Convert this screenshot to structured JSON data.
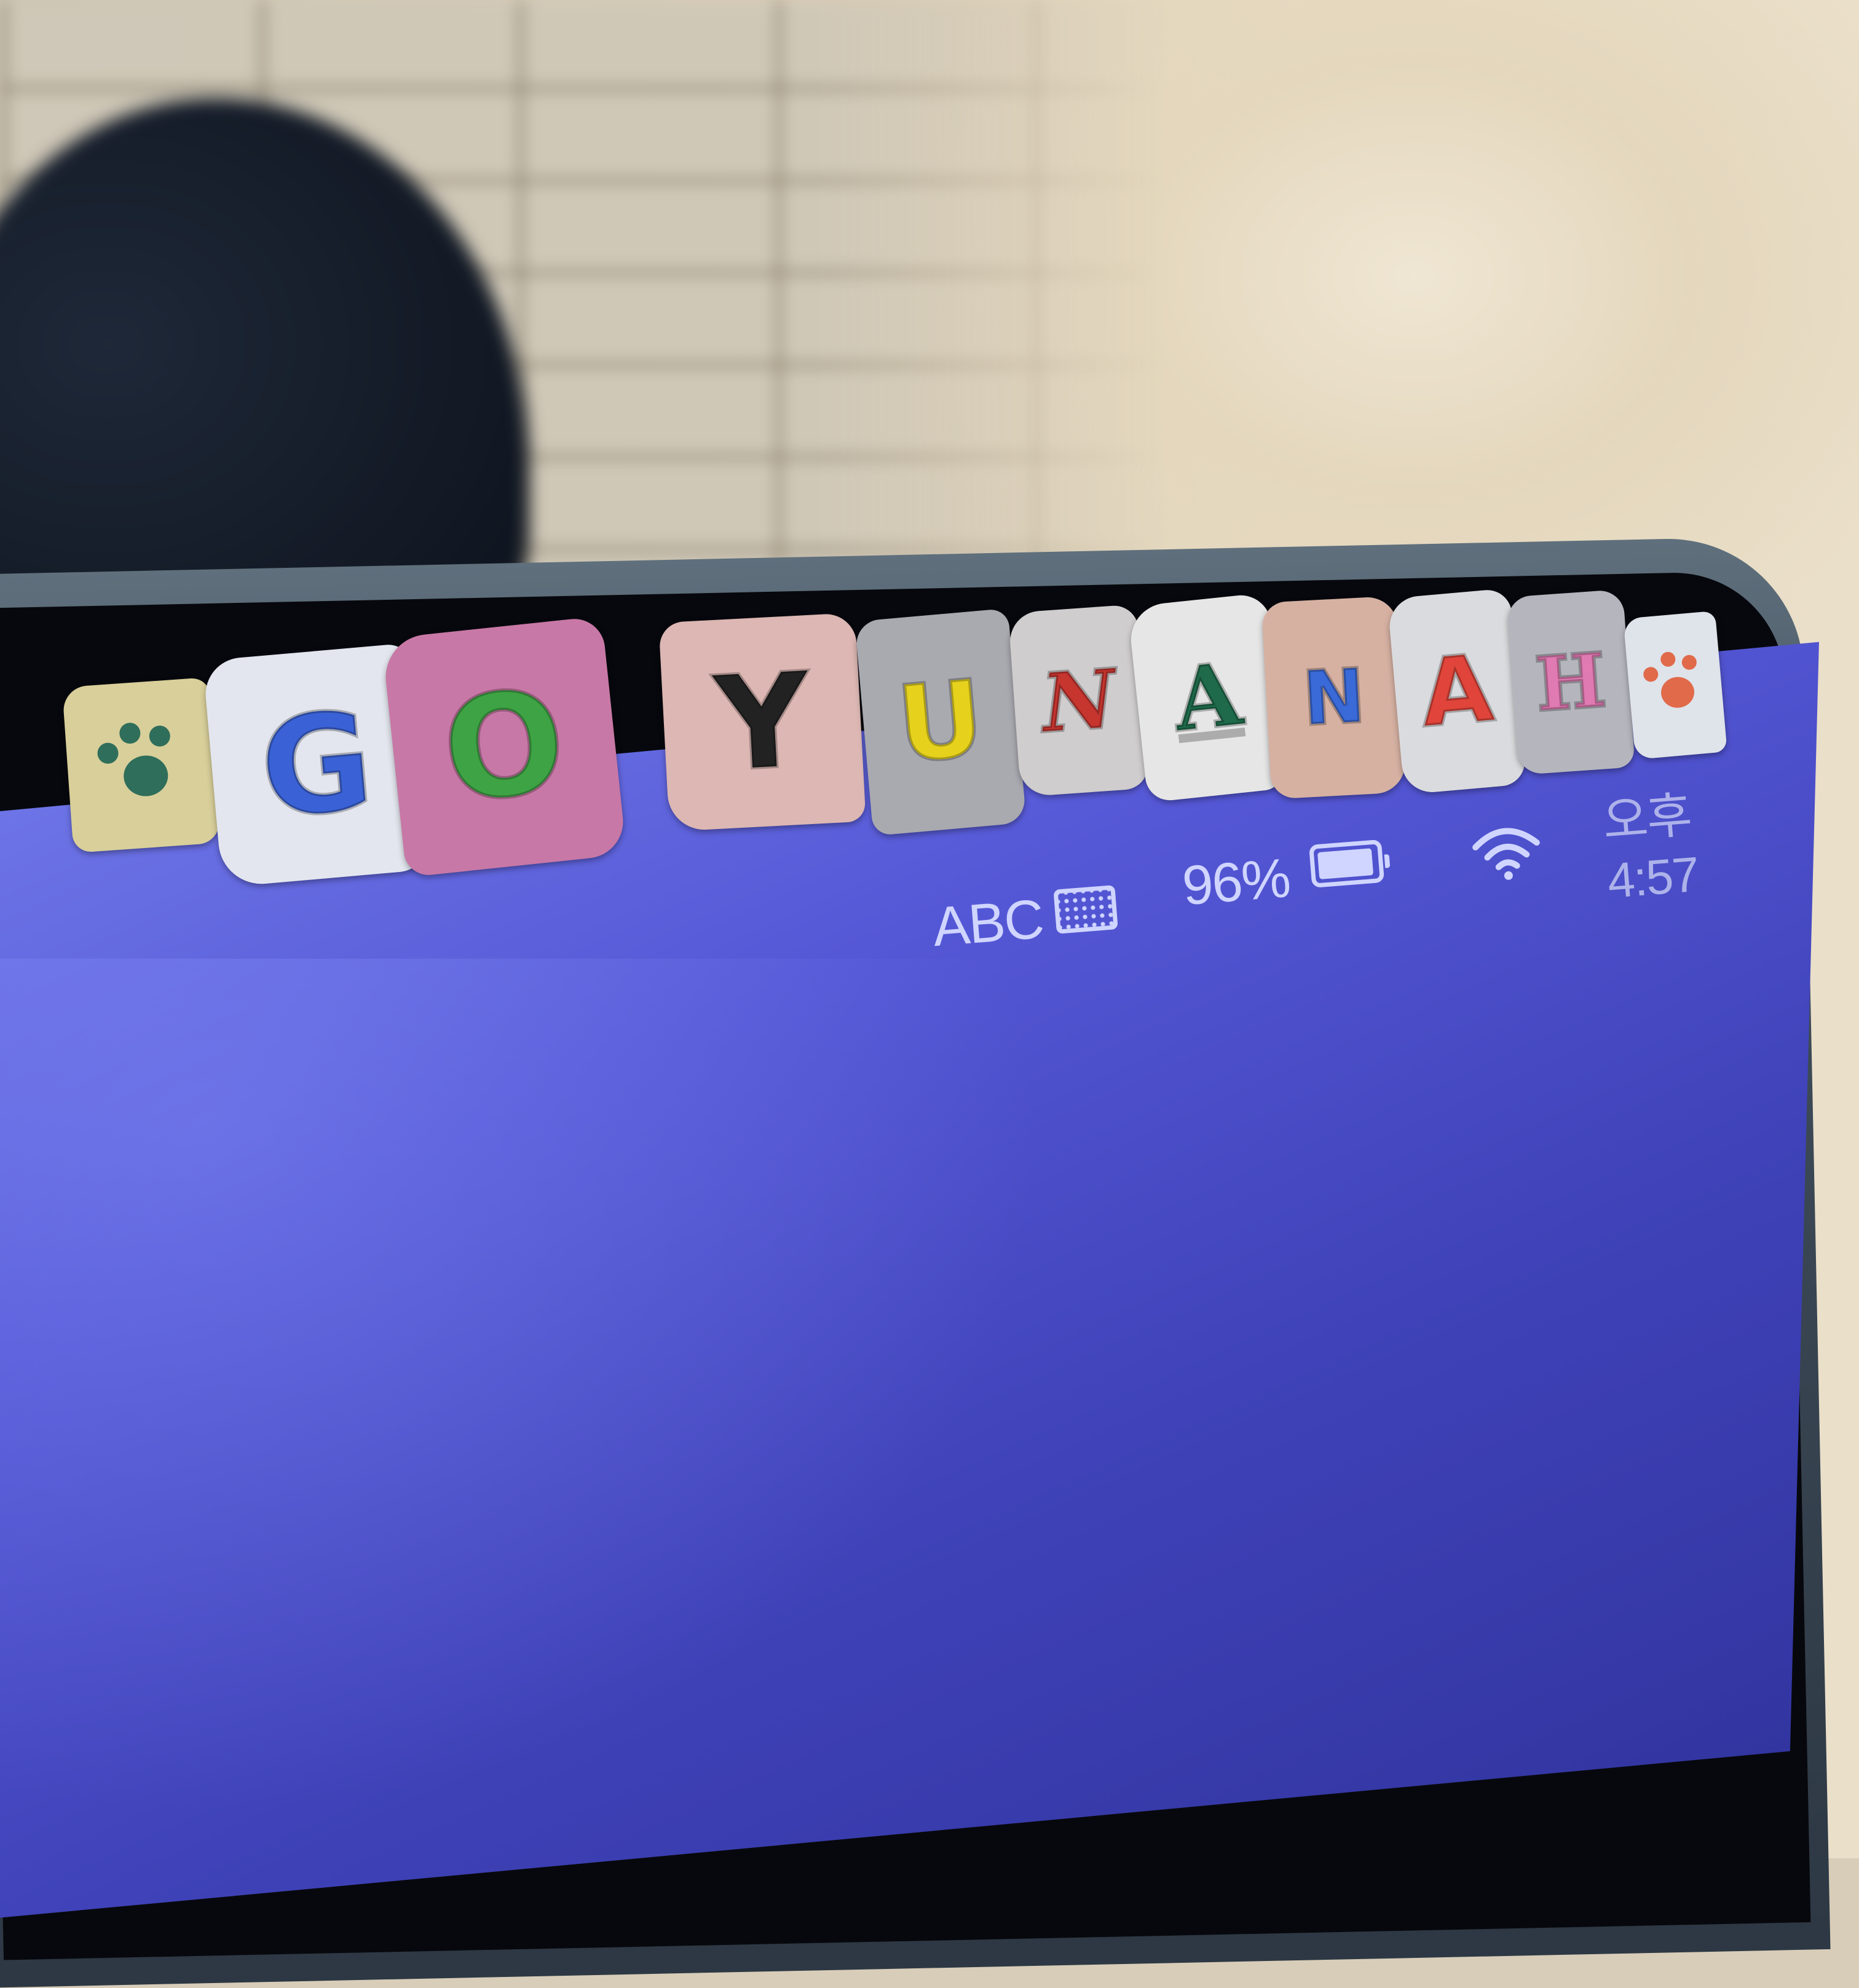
{
  "menubar": {
    "input_source": "ABC",
    "keyboard_icon": "keyboard-icon",
    "battery_percent": "96%",
    "battery_level": 0.96,
    "battery_icon": "battery-icon",
    "wifi_icon": "wifi-icon",
    "clock": "오후 4:57"
  },
  "stickers": {
    "letters": [
      "G",
      "O",
      "Y",
      "U",
      "N",
      "A",
      "N",
      "A",
      "H"
    ],
    "paw_icon": "paw-print-icon",
    "colors": {
      "paw_left": "#2f6e5a",
      "paw_right": "#e06a4a",
      "G": "#3a62d6",
      "O": "#3ea344",
      "Y": "#222222",
      "U": "#e6d21c",
      "N1": "#c7352f",
      "A1": "#1e6a4a",
      "N2": "#3a6ad8",
      "A2": "#e0443a",
      "H": "#e07ab2"
    }
  },
  "screen": {
    "wallpaper_color": "#5558d6"
  }
}
